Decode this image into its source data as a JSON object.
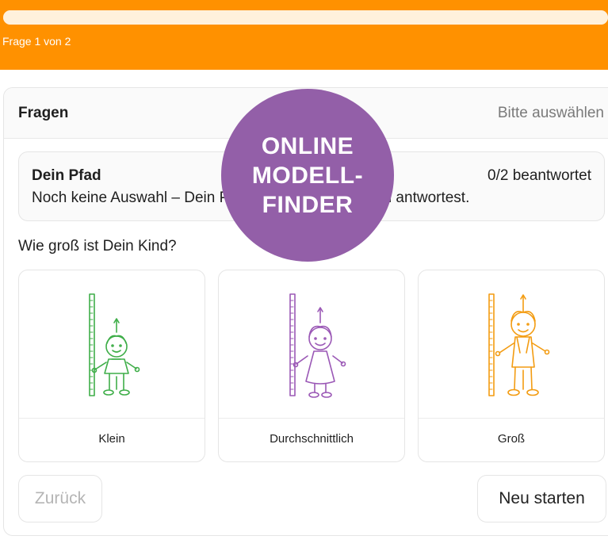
{
  "progress": {
    "step_text": "Frage 1 von 2",
    "fraction": 1.0
  },
  "card": {
    "title": "Fragen",
    "hint": "Bitte auswählen"
  },
  "path": {
    "title": "Dein Pfad",
    "count": "0/2 beantwortet",
    "description": "Noch keine Auswahl – Dein Pfad erscheint, sobald Du antwortest."
  },
  "question": "Wie groß ist Dein Kind?",
  "options": [
    {
      "label": "Klein",
      "icon": "small-child-height-chart-icon",
      "color": "#3fae49"
    },
    {
      "label": "Durchschnittlich",
      "icon": "average-child-height-chart-icon",
      "color": "#9b59b6"
    },
    {
      "label": "Groß",
      "icon": "tall-child-height-chart-icon",
      "color": "#f39c12"
    }
  ],
  "buttons": {
    "back": "Zurück",
    "restart": "Neu starten"
  },
  "badge": {
    "line1": "ONLINE",
    "line2": "MODELL-",
    "line3": "FINDER"
  },
  "colors": {
    "accent": "#ff9100",
    "badge": "#935fa8"
  }
}
